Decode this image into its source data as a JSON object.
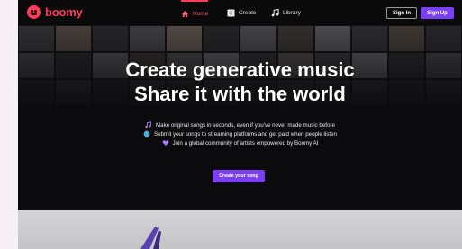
{
  "brand": {
    "name": "boomy",
    "icon": "boomy-face-icon",
    "color": "#ff3b5c"
  },
  "nav": {
    "links": [
      {
        "label": "Home",
        "icon": "house-icon",
        "active": true
      },
      {
        "label": "Create",
        "icon": "plus-square-icon",
        "active": false
      },
      {
        "label": "Library",
        "icon": "music-note-icon",
        "active": false
      }
    ],
    "sign_in": "Sign In",
    "sign_up": "Sign Up"
  },
  "hero": {
    "headline_line1": "Create generative music",
    "headline_line2": "Share it with the world",
    "bullets": [
      {
        "icon": "music-notes-icon",
        "text": "Make original songs in seconds, even if you've never made music before"
      },
      {
        "icon": "globe-icon",
        "text": "Submit your songs to streaming platforms and get paid when people listen"
      },
      {
        "icon": "heart-icon",
        "text": "Join a global community of artists empowered by Boomy AI"
      }
    ],
    "cta": "Create your song"
  },
  "colors": {
    "accent": "#7b3ff2",
    "background": "#0b0b0d"
  }
}
